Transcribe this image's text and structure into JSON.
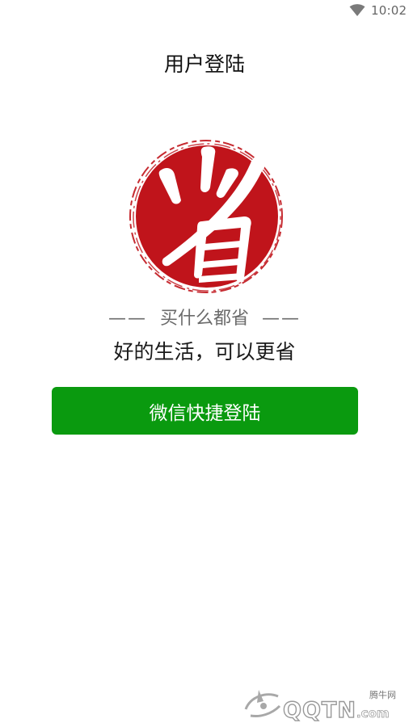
{
  "status_bar": {
    "time": "10:02",
    "wifi_icon": "wifi-icon"
  },
  "page_title": "用户登陆",
  "logo": {
    "icon": "seal-logo",
    "character": "省",
    "color": "#c0141b"
  },
  "tagline": {
    "dash_left": "——",
    "text": "买什么都省",
    "dash_right": "——"
  },
  "slogan": "好的生活，可以更省",
  "wechat_login_button": {
    "label": "微信快捷登陆",
    "color": "#0a9a0f"
  },
  "watermark": {
    "cn": "腾牛网",
    "logo": "QQTN",
    "domain": ".com"
  }
}
